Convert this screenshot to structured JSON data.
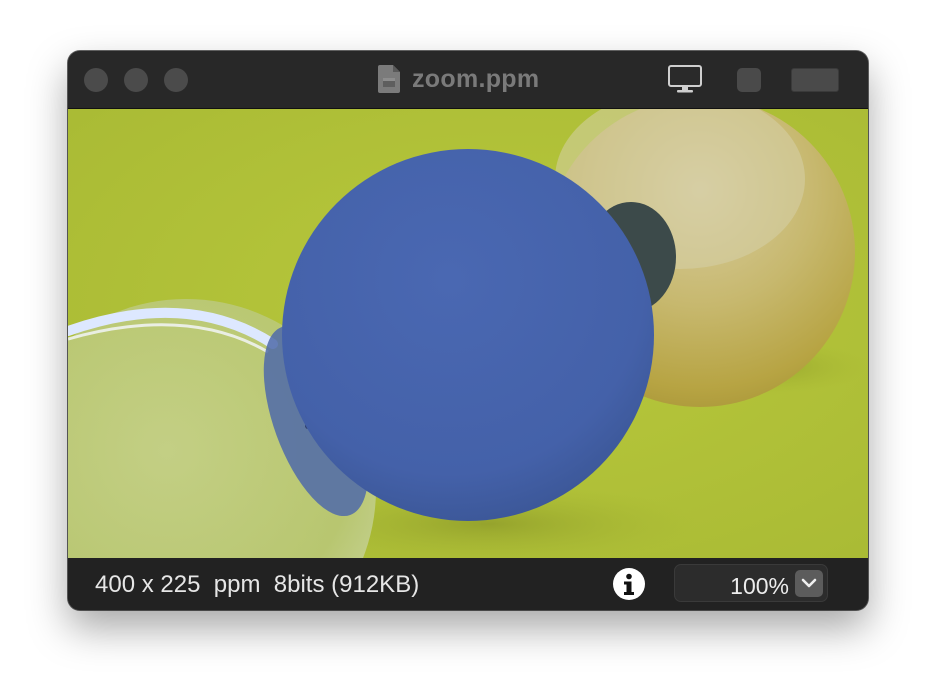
{
  "window": {
    "title": "zoom.ppm"
  },
  "titlebar": {
    "buttons": {
      "close": "window-close-button",
      "minimize": "window-minimize-button",
      "zoom": "window-zoom-button"
    },
    "icons": [
      "file-icon",
      "monitor-icon",
      "square-icon",
      "wide-rect-icon"
    ]
  },
  "image": {
    "description_icon": "rendered-spheres-image",
    "colors": {
      "ground": "#b4c43a",
      "blue_sphere": "#4562ab",
      "gold_sphere": "#c8b46a",
      "glass_sphere": "#dfe7c8"
    }
  },
  "status": {
    "info": "400 x 225  ppm  8bits (912KB)",
    "zoom": "100%",
    "zoom_options": [
      "100%"
    ]
  },
  "colors": {
    "titlebar": "#282828",
    "statusbar": "#222222",
    "text": "#e6e6e6",
    "title_text": "#7a7a7a"
  }
}
